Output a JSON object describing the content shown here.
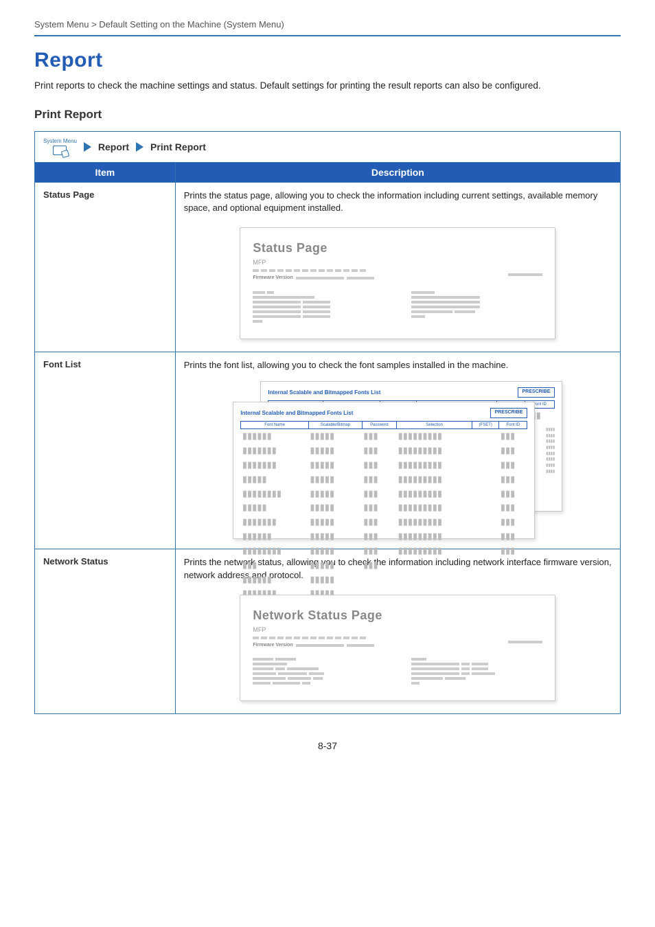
{
  "breadcrumb": "System Menu > Default Setting on the Machine (System Menu)",
  "heading": "Report",
  "intro": "Print reports to check the machine settings and status. Default settings for printing the result reports can also be configured.",
  "section_title": "Print Report",
  "nav": {
    "icon_label": "System Menu",
    "crumb1": "Report",
    "crumb2": "Print Report"
  },
  "table": {
    "col_item": "Item",
    "col_desc": "Description",
    "rows": [
      {
        "item": "Status Page",
        "desc": "Prints the status page, allowing you to check the information including current settings, available memory space, and optional equipment installed.",
        "mock": "status"
      },
      {
        "item": "Font List",
        "desc": "Prints the font list, allowing you to check the font samples installed in the machine.",
        "mock": "font"
      },
      {
        "item": "Network Status",
        "desc": "Prints the network status, allowing you to check the information including network interface firmware version, network address and protocol.",
        "mock": "network"
      }
    ]
  },
  "mock": {
    "status_title": "Status Page",
    "status_sub": "MFP",
    "firmware_label": "Firmware Version",
    "network_title": "Network Status Page",
    "network_sub": "MFP",
    "font_title": "Internal Scalable and Bitmapped Fonts List",
    "font_prescribe": "PRESCRIBE",
    "font_cols": [
      "Font Name",
      "Scalable/Bitmap",
      "Password",
      "Selection",
      "(FSET)",
      "Font ID"
    ]
  },
  "page_number": "8-37"
}
